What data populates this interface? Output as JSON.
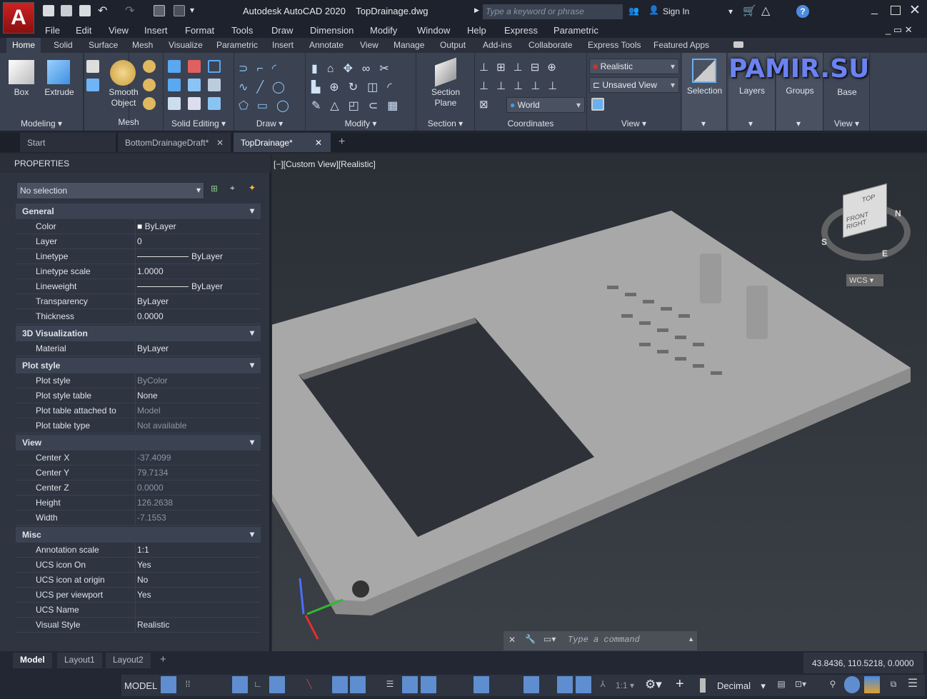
{
  "app": {
    "title": "Autodesk AutoCAD 2020",
    "file": "TopDrainage.dwg",
    "logo": "A",
    "search_placeholder": "Type a keyword or phrase",
    "sign_in": "Sign In"
  },
  "menus": [
    "File",
    "Edit",
    "View",
    "Insert",
    "Format",
    "Tools",
    "Draw",
    "Dimension",
    "Modify",
    "Window",
    "Help",
    "Express",
    "Parametric"
  ],
  "ribbon_tabs": [
    "Home",
    "Solid",
    "Surface",
    "Mesh",
    "Visualize",
    "Parametric",
    "Insert",
    "Annotate",
    "View",
    "Manage",
    "Output",
    "Add-ins",
    "Collaborate",
    "Express Tools",
    "Featured Apps"
  ],
  "panels": {
    "modeling": "Modeling",
    "box": "Box",
    "extrude": "Extrude",
    "mesh": "Mesh",
    "smooth": "Smooth",
    "object": "Object",
    "solid_editing": "Solid Editing",
    "draw": "Draw",
    "modify": "Modify",
    "section": "Section",
    "section_plane_1": "Section",
    "section_plane_2": "Plane",
    "coordinates": "Coordinates",
    "world": "World",
    "view": "View",
    "visual_style": "Realistic",
    "named_view": "Unsaved View",
    "selection": "Selection",
    "layers": "Layers",
    "groups": "Groups",
    "base": "Base",
    "view2": "View"
  },
  "watermark": "PAMIR.SU",
  "file_tabs": [
    "Start",
    "BottomDrainageDraft*",
    "TopDrainage*"
  ],
  "properties": {
    "title": "PROPERTIES",
    "selection": "No selection",
    "sections": [
      {
        "name": "General",
        "rows": [
          [
            "Color",
            "ByLayer",
            false
          ],
          [
            "Layer",
            "0",
            false
          ],
          [
            "Linetype",
            "ByLayer",
            false
          ],
          [
            "Linetype scale",
            "1.0000",
            false
          ],
          [
            "Lineweight",
            "ByLayer",
            false
          ],
          [
            "Transparency",
            "ByLayer",
            false
          ],
          [
            "Thickness",
            "0.0000",
            false
          ]
        ]
      },
      {
        "name": "3D Visualization",
        "rows": [
          [
            "Material",
            "ByLayer",
            false
          ]
        ]
      },
      {
        "name": "Plot style",
        "rows": [
          [
            "Plot style",
            "ByColor",
            true
          ],
          [
            "Plot style table",
            "None",
            false
          ],
          [
            "Plot table attached to",
            "Model",
            true
          ],
          [
            "Plot table type",
            "Not available",
            true
          ]
        ]
      },
      {
        "name": "View",
        "rows": [
          [
            "Center X",
            "-37.4099",
            true
          ],
          [
            "Center Y",
            "79.7134",
            true
          ],
          [
            "Center Z",
            "0.0000",
            true
          ],
          [
            "Height",
            "126.2638",
            true
          ],
          [
            "Width",
            "-7.1553",
            true
          ]
        ]
      },
      {
        "name": "Misc",
        "rows": [
          [
            "Annotation scale",
            "1:1",
            false
          ],
          [
            "UCS icon On",
            "Yes",
            false
          ],
          [
            "UCS icon at origin",
            "No",
            false
          ],
          [
            "UCS per viewport",
            "Yes",
            false
          ],
          [
            "UCS Name",
            "",
            false
          ],
          [
            "Visual Style",
            "Realistic",
            false
          ]
        ]
      }
    ]
  },
  "viewport": {
    "label": "[−][Custom View][Realistic]",
    "wcs": "WCS",
    "cube": {
      "top": "TOP",
      "front": "FRONT",
      "right": "RIGHT"
    },
    "compass": [
      "N",
      "E",
      "S"
    ]
  },
  "command": {
    "placeholder": "Type a command"
  },
  "layout_tabs": [
    "Model",
    "Layout1",
    "Layout2"
  ],
  "coordinates": "43.8436, 110.5218, 0.0000",
  "status": {
    "model": "MODEL",
    "scale": "1:1",
    "units": "Decimal"
  },
  "colors": {
    "accent": "#5e8ecf",
    "bg": "#222733",
    "panel": "#3b4251"
  }
}
